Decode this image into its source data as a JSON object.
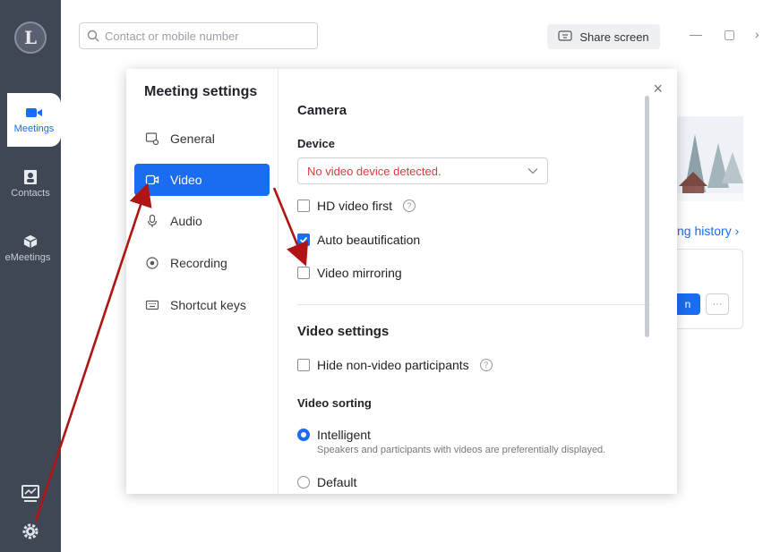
{
  "rail": {
    "logo_letter": "L",
    "items": [
      {
        "label": "Meetings",
        "icon": "video-camera-icon",
        "active": true
      },
      {
        "label": "Contacts",
        "icon": "contact-card-icon",
        "active": false
      },
      {
        "label": "eMeetings",
        "icon": "cube-icon",
        "active": false
      }
    ],
    "bottom_icons": [
      "monitor-chart-icon",
      "gear-icon"
    ]
  },
  "topbar": {
    "search_placeholder": "Contact or mobile number",
    "share_label": "Share screen",
    "window_controls": [
      "—",
      "▢",
      "›"
    ]
  },
  "background": {
    "history_link": "ng history ›",
    "blue_button": "n",
    "more_button": "···"
  },
  "dialog": {
    "title": "Meeting settings",
    "nav": [
      {
        "label": "General",
        "icon": "general-icon",
        "active": false
      },
      {
        "label": "Video",
        "icon": "video-icon",
        "active": true
      },
      {
        "label": "Audio",
        "icon": "microphone-icon",
        "active": false
      },
      {
        "label": "Recording",
        "icon": "record-icon",
        "active": false
      },
      {
        "label": "Shortcut keys",
        "icon": "keyboard-icon",
        "active": false
      }
    ],
    "close": "×",
    "camera": {
      "heading": "Camera",
      "device_label": "Device",
      "device_value": "No video device detected.",
      "options": [
        {
          "label": "HD video first",
          "checked": false,
          "help": "?"
        },
        {
          "label": "Auto beautification",
          "checked": true
        },
        {
          "label": "Video mirroring",
          "checked": false
        }
      ]
    },
    "video_settings": {
      "heading": "Video settings",
      "hide_non_video": {
        "label": "Hide non-video participants",
        "checked": false,
        "help": "?"
      },
      "sorting_label": "Video sorting",
      "sorting_options": [
        {
          "label": "Intelligent",
          "selected": true,
          "description": "Speakers and participants with videos are preferentially displayed."
        },
        {
          "label": "Default",
          "selected": false
        }
      ]
    }
  },
  "colors": {
    "accent": "#1a6cf0",
    "rail": "#3f4654",
    "error": "#e03b3b",
    "annotation": "#b01414"
  }
}
